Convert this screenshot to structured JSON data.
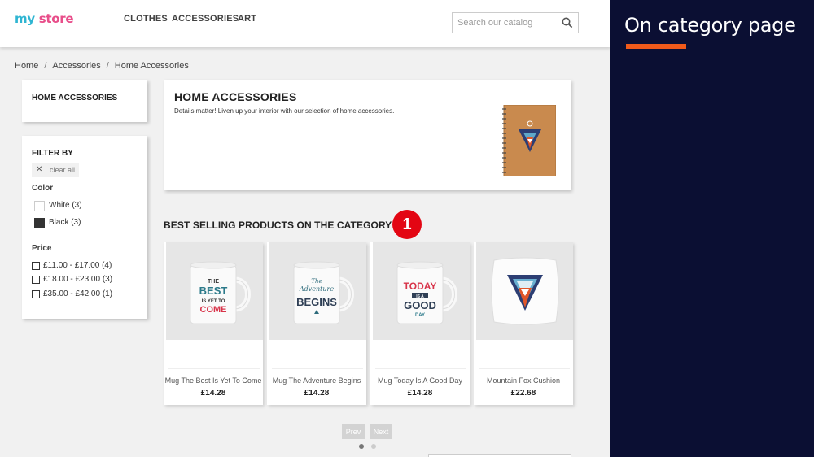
{
  "header": {
    "logo": {
      "my": "my",
      "store": "store"
    },
    "nav": [
      "CLOTHES",
      "ACCESSORIES",
      "ART"
    ],
    "search_placeholder": "Search our catalog"
  },
  "breadcrumb": [
    "Home",
    "Accessories",
    "Home Accessories"
  ],
  "category_panel": {
    "title": "HOME ACCESSORIES"
  },
  "filters": {
    "title": "FILTER BY",
    "clear_all": "clear all",
    "color": {
      "title": "Color",
      "options": [
        {
          "label": "White (3)",
          "swatch": "#ffffff"
        },
        {
          "label": "Black (3)",
          "swatch": "#333333"
        }
      ]
    },
    "price": {
      "title": "Price",
      "options": [
        "£11.00 - £17.00 (4)",
        "£18.00 - £23.00 (3)",
        "£35.00 - £42.00 (1)"
      ]
    }
  },
  "category_description": {
    "title": "HOME ACCESSORIES",
    "text": "Details matter! Liven up your interior with our selection of home accessories."
  },
  "best_selling": {
    "title": "BEST SELLING PRODUCTS ON THE CATEGORY",
    "badge": "1",
    "products": [
      {
        "name": "Mug The Best Is Yet To Come",
        "price": "£14.28",
        "art": {
          "a": "THE",
          "b": "BEST",
          "c": "IS YET TO",
          "d": "COME"
        }
      },
      {
        "name": "Mug The Adventure Begins",
        "price": "£14.28",
        "art": {
          "a": "The",
          "b": "Adventure",
          "c": "BEGINS"
        }
      },
      {
        "name": "Mug Today Is A Good Day",
        "price": "£14.28",
        "art": {
          "a": "TODAY",
          "b": "IS A",
          "c": "GOOD",
          "d": "DAY"
        }
      },
      {
        "name": "Mountain Fox Cushion",
        "price": "£22.68"
      }
    ],
    "pager": {
      "prev": "Prev",
      "next": "Next",
      "pages": 2,
      "active_page": 1
    }
  },
  "side_panel": {
    "title": "On category page"
  },
  "colors": {
    "accent": "#f05a1a",
    "badge": "#e30613",
    "sidebar": "#0b0f33"
  }
}
